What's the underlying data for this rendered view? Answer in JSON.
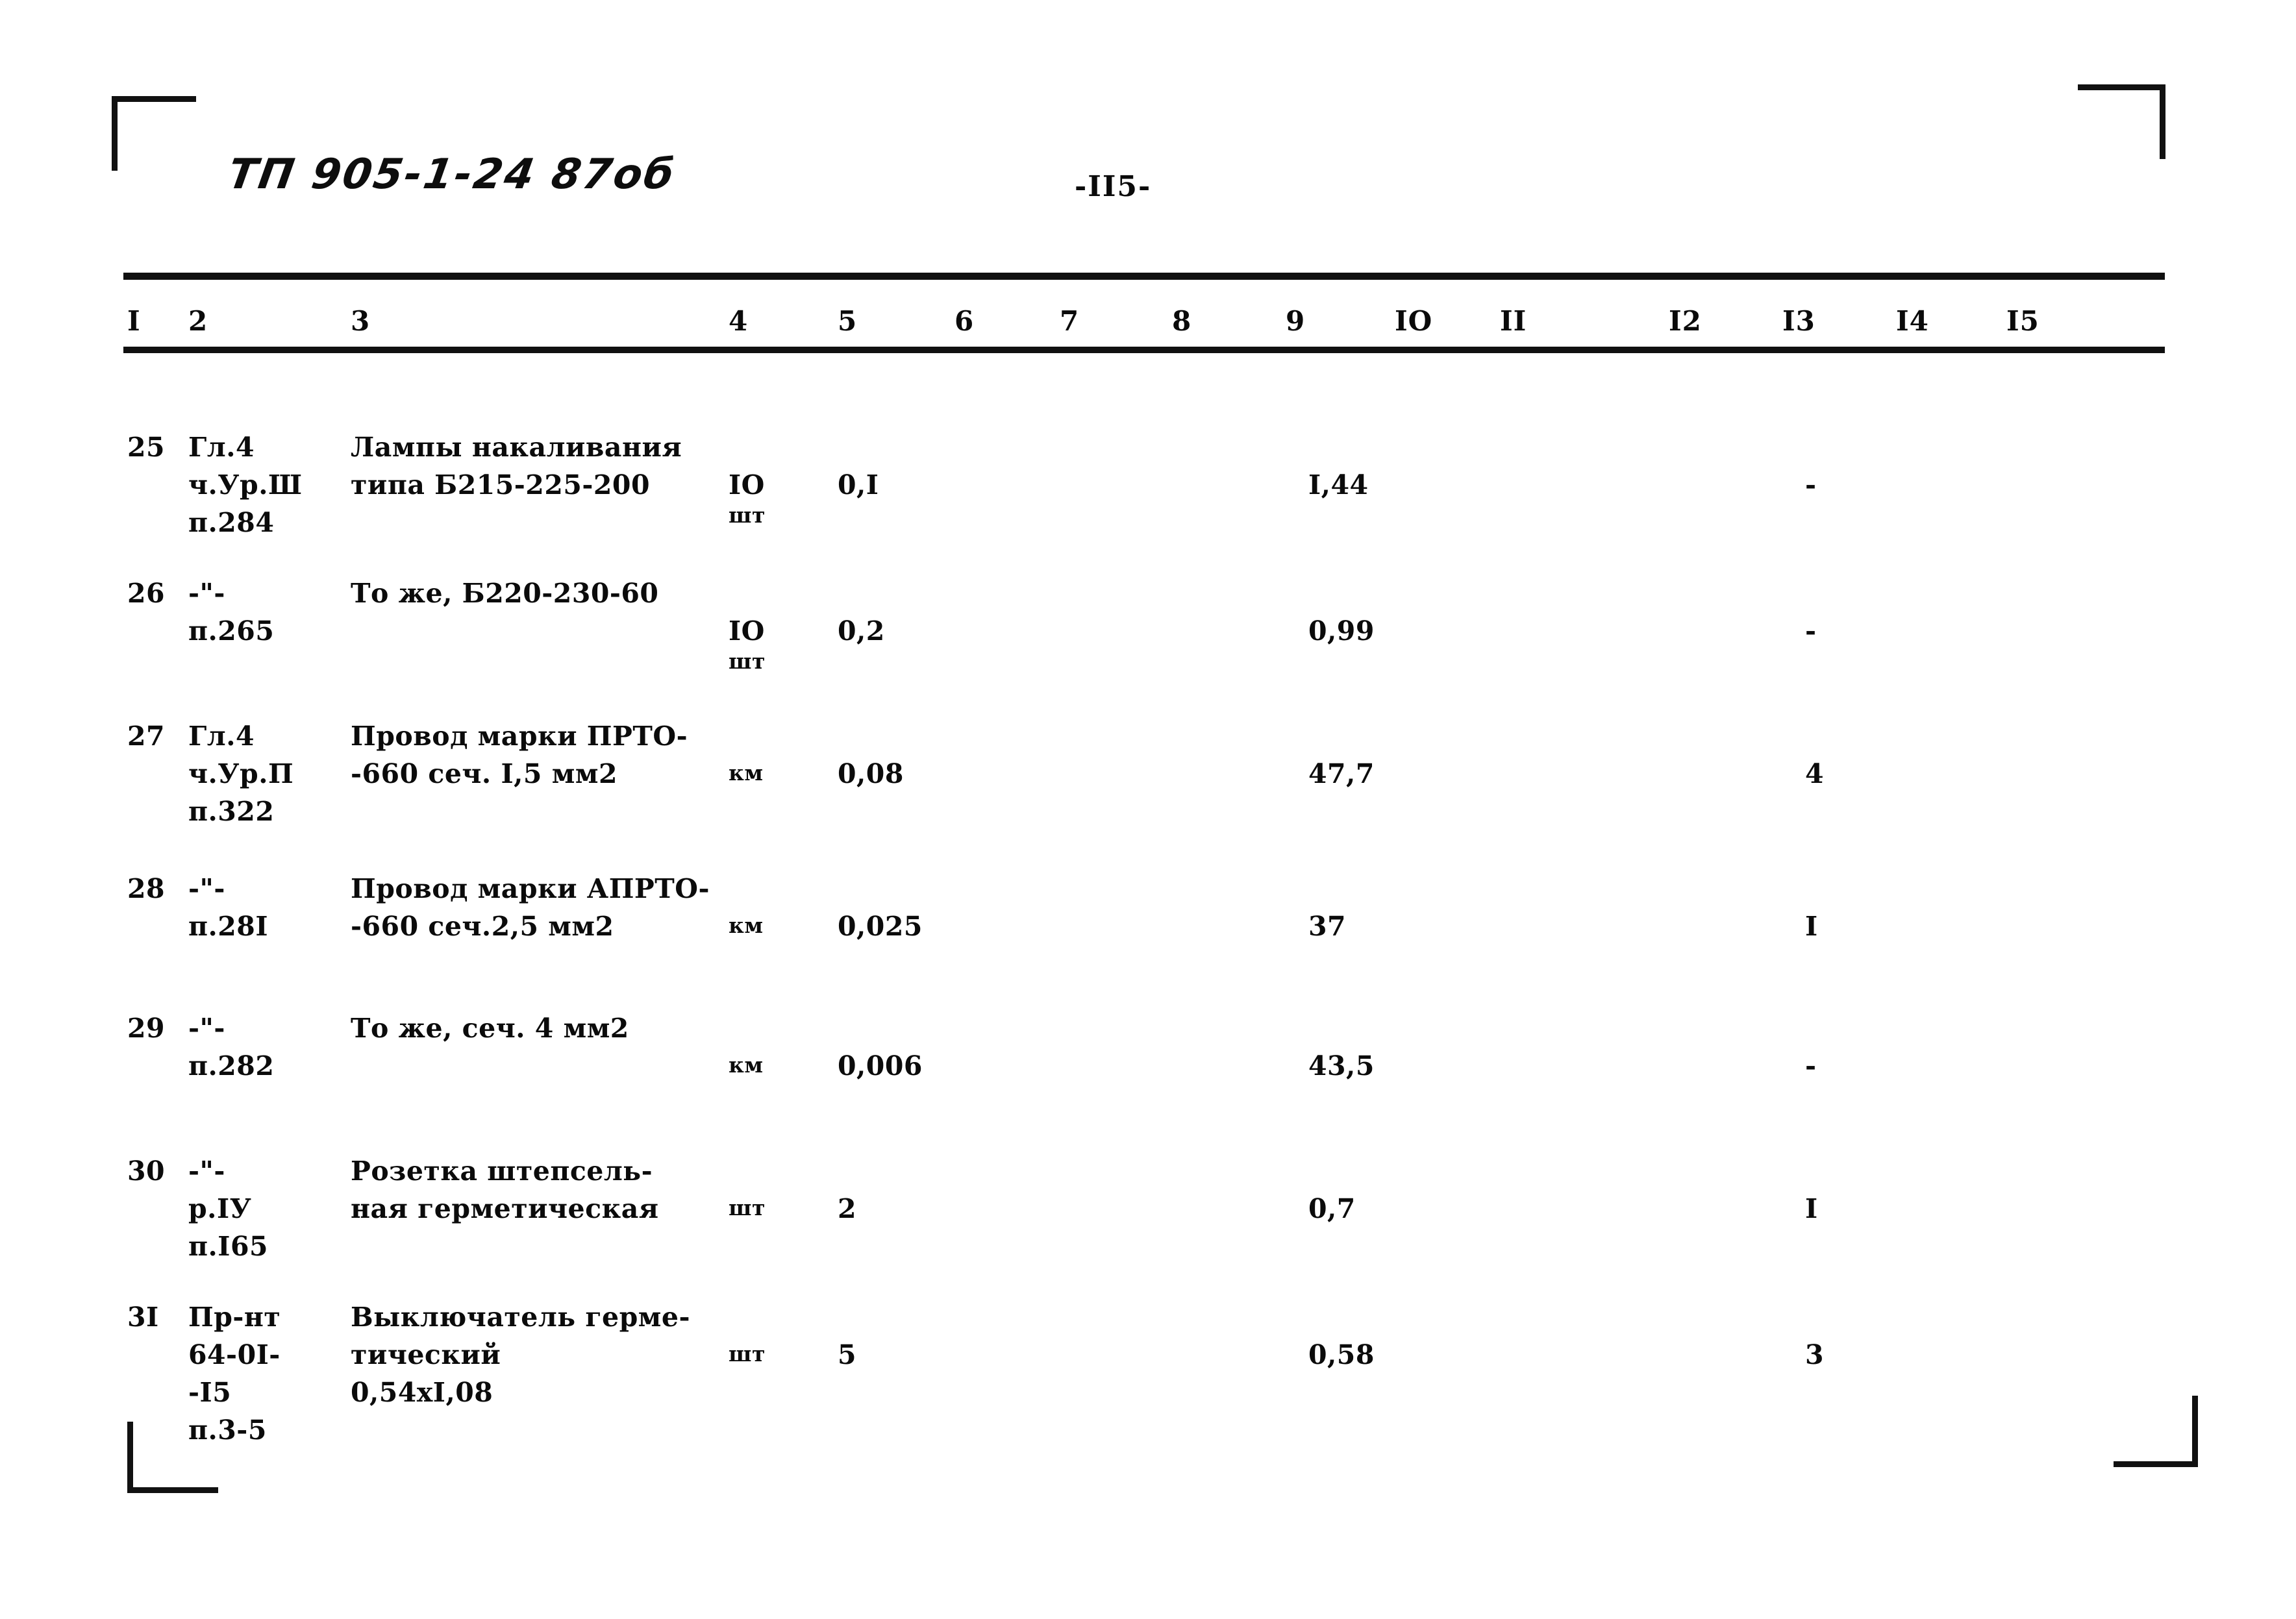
{
  "document": {
    "code": "ТП  905-1-24 87об",
    "page_number": "-II5-"
  },
  "table": {
    "column_headers": [
      "I",
      "2",
      "3",
      "4",
      "5",
      "6",
      "7",
      "8",
      "9",
      "IO",
      "II",
      "I2",
      "I3",
      "I4",
      "I5"
    ],
    "rows": [
      {
        "num": "25",
        "ref": [
          "Гл.4",
          "ч.Ур.Ш",
          "п.284"
        ],
        "name": [
          "Лампы накаливания",
          "типа Б215-225-200"
        ],
        "unit_top": "IO",
        "unit_bottom": "шт",
        "col5": "0,I",
        "col9": "I,44",
        "col13": "-"
      },
      {
        "num": "26",
        "ref": [
          "-\"-",
          "п.265"
        ],
        "name": [
          "То же, Б220-230-60"
        ],
        "unit_top": "IO",
        "unit_bottom": "шт",
        "col5": "0,2",
        "col9": "0,99",
        "col13": "-"
      },
      {
        "num": "27",
        "ref": [
          "Гл.4",
          "ч.Ур.П",
          "п.322"
        ],
        "name": [
          "Провод марки ПРТО-",
          "-660 сеч. I,5 мм2"
        ],
        "unit_top": "",
        "unit_bottom": "км",
        "col5": "0,08",
        "col9": "47,7",
        "col13": "4"
      },
      {
        "num": "28",
        "ref": [
          "-\"-",
          "п.28I"
        ],
        "name": [
          "Провод марки АПРТО-",
          "-660 сеч.2,5 мм2"
        ],
        "unit_top": "",
        "unit_bottom": "км",
        "col5": "0,025",
        "col9": "37",
        "col13": "I"
      },
      {
        "num": "29",
        "ref": [
          "-\"-",
          "п.282"
        ],
        "name": [
          "То же, сеч. 4 мм2"
        ],
        "unit_top": "",
        "unit_bottom": "км",
        "col5": "0,006",
        "col9": "43,5",
        "col13": "-"
      },
      {
        "num": "30",
        "ref": [
          "-\"-",
          "р.IУ",
          "п.I65"
        ],
        "name": [
          "Розетка штепсель-",
          "ная герметическая"
        ],
        "unit_top": "",
        "unit_bottom": "шт",
        "col5": "2",
        "col9": "0,7",
        "col13": "I"
      },
      {
        "num": "3I",
        "ref": [
          "Пр-нт",
          "64-0I-",
          "-I5",
          "п.3-5"
        ],
        "name": [
          "Выключатель герме-",
          "тический",
          "0,54хI,08"
        ],
        "unit_top": "",
        "unit_bottom": "шт",
        "col5": "5",
        "col9": "0,58",
        "col13": "3"
      }
    ]
  }
}
